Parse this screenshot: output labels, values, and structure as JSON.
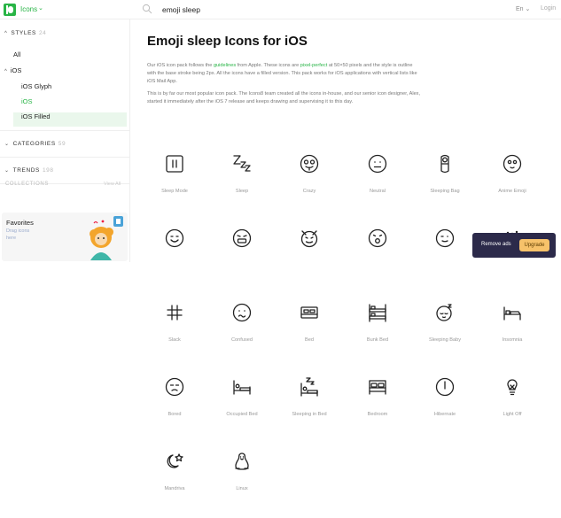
{
  "topbar": {
    "brand": "Icons",
    "search_value": "emoji sleep",
    "language": "En",
    "login": "Login"
  },
  "sidebar": {
    "styles_label": "STYLES",
    "styles_count": "24",
    "all": "All",
    "ios": "iOS",
    "ios_glyph": "iOS Glyph",
    "ios_selected": "iOS",
    "ios_filled": "iOS Filled",
    "categories_label": "CATEGORIES",
    "categories_count": "59",
    "trends_label": "TRENDS",
    "trends_count": "198",
    "collections_label": "COLLECTIONS",
    "view_all": "View All",
    "favorites_title": "Favorites",
    "favorites_desc": "Drag icons here"
  },
  "main": {
    "title": "Emoji sleep Icons for iOS",
    "para1_a": "Our iOS icon pack follows the ",
    "para1_link1": "guidelines",
    "para1_b": " from Apple. These icons are ",
    "para1_link2": "pixel-perfect",
    "para1_c": " at 50×50 pixels and the style is outline with the base stroke being 2px. All the icons have a filled version. This pack works for iOS applications with vertical lists like iOS Mail App.",
    "para2": "This is by far our most popular icon pack. The Icons8 team created all the icons in-house, and our senior icon designer, Alex, started it immediately after the iOS 7 release and keeps drawing and supervising it to this day.",
    "icons": [
      {
        "label": "Sleep Mode",
        "icon": "sleep-mode-icon"
      },
      {
        "label": "Sleep",
        "icon": "sleep-icon"
      },
      {
        "label": "Crazy",
        "icon": "crazy-icon"
      },
      {
        "label": "Neutral",
        "icon": "neutral-icon"
      },
      {
        "label": "Sleeping Bag",
        "icon": "sleeping-bag-icon"
      },
      {
        "label": "Anime Emoji",
        "icon": "anime-emoji-icon"
      },
      {
        "label": "",
        "icon": "smile-icon"
      },
      {
        "label": "",
        "icon": "grimace-icon"
      },
      {
        "label": "",
        "icon": "devil-icon"
      },
      {
        "label": "",
        "icon": "surprised-icon"
      },
      {
        "label": "",
        "icon": "wink-icon"
      },
      {
        "label": "",
        "icon": "mask-icon"
      },
      {
        "label": "Slack",
        "icon": "slack-icon"
      },
      {
        "label": "Confused",
        "icon": "confused-icon"
      },
      {
        "label": "Bed",
        "icon": "bed-icon"
      },
      {
        "label": "Bunk Bed",
        "icon": "bunk-bed-icon"
      },
      {
        "label": "Sleeping Baby",
        "icon": "sleeping-baby-icon"
      },
      {
        "label": "Insomnia",
        "icon": "insomnia-icon"
      },
      {
        "label": "Bored",
        "icon": "bored-icon"
      },
      {
        "label": "Occupied Bed",
        "icon": "occupied-bed-icon"
      },
      {
        "label": "Sleeping in Bed",
        "icon": "sleeping-in-bed-icon"
      },
      {
        "label": "Bedroom",
        "icon": "bedroom-icon"
      },
      {
        "label": "Hibernate",
        "icon": "hibernate-icon"
      },
      {
        "label": "Light Off",
        "icon": "light-off-icon"
      },
      {
        "label": "Mandriva",
        "icon": "mandriva-icon"
      },
      {
        "label": "Linux",
        "icon": "linux-icon"
      }
    ]
  },
  "ads": {
    "text": "Remove ads",
    "button": "Upgrade"
  },
  "colors": {
    "accent": "#28b446",
    "ads_bg": "#2c2a4a",
    "upgrade_bg": "#f7c26a"
  }
}
